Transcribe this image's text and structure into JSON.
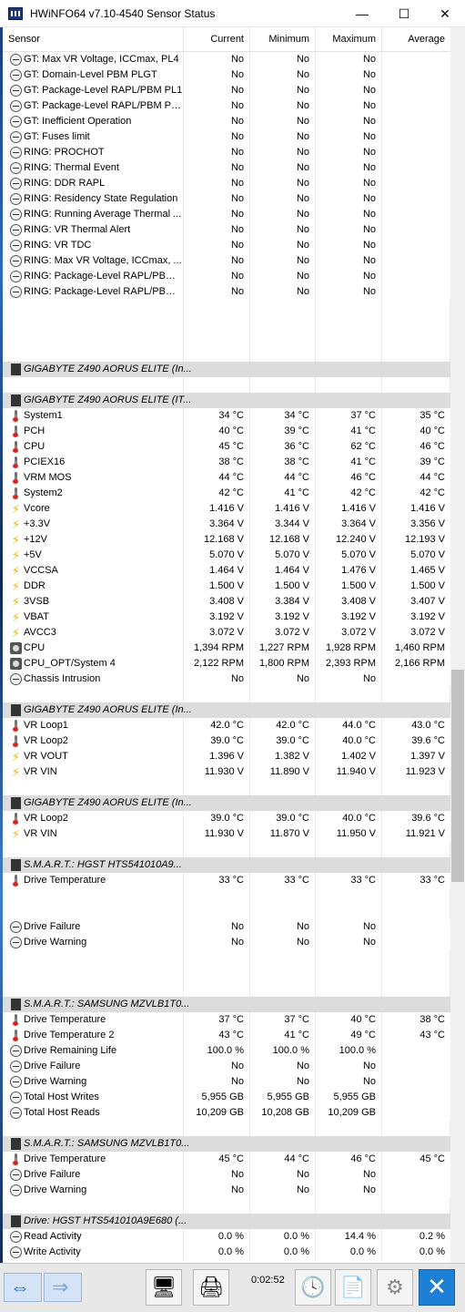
{
  "window": {
    "title": "HWiNFO64 v7.10-4540 Sensor Status"
  },
  "columns": {
    "sensor": "Sensor",
    "current": "Current",
    "minimum": "Minimum",
    "maximum": "Maximum",
    "average": "Average"
  },
  "rows": [
    {
      "type": "data",
      "icon": "clock-icon",
      "name": "GT: Max VR Voltage, ICCmax, PL4",
      "cur": "No",
      "min": "No",
      "max": "No",
      "avg": ""
    },
    {
      "type": "data",
      "icon": "clock-icon",
      "name": "GT: Domain-Level PBM PLGT",
      "cur": "No",
      "min": "No",
      "max": "No",
      "avg": ""
    },
    {
      "type": "data",
      "icon": "clock-icon",
      "name": "GT: Package-Level RAPL/PBM PL1",
      "cur": "No",
      "min": "No",
      "max": "No",
      "avg": ""
    },
    {
      "type": "data",
      "icon": "clock-icon",
      "name": "GT: Package-Level RAPL/PBM PL2...",
      "cur": "No",
      "min": "No",
      "max": "No",
      "avg": ""
    },
    {
      "type": "data",
      "icon": "clock-icon",
      "name": "GT: Inefficient Operation",
      "cur": "No",
      "min": "No",
      "max": "No",
      "avg": ""
    },
    {
      "type": "data",
      "icon": "clock-icon",
      "name": "GT: Fuses limit",
      "cur": "No",
      "min": "No",
      "max": "No",
      "avg": ""
    },
    {
      "type": "data",
      "icon": "clock-icon",
      "name": "RING: PROCHOT",
      "cur": "No",
      "min": "No",
      "max": "No",
      "avg": ""
    },
    {
      "type": "data",
      "icon": "clock-icon",
      "name": "RING: Thermal Event",
      "cur": "No",
      "min": "No",
      "max": "No",
      "avg": ""
    },
    {
      "type": "data",
      "icon": "clock-icon",
      "name": "RING: DDR RAPL",
      "cur": "No",
      "min": "No",
      "max": "No",
      "avg": ""
    },
    {
      "type": "data",
      "icon": "clock-icon",
      "name": "RING: Residency State Regulation",
      "cur": "No",
      "min": "No",
      "max": "No",
      "avg": ""
    },
    {
      "type": "data",
      "icon": "clock-icon",
      "name": "RING: Running Average Thermal ...",
      "cur": "No",
      "min": "No",
      "max": "No",
      "avg": ""
    },
    {
      "type": "data",
      "icon": "clock-icon",
      "name": "RING: VR Thermal Alert",
      "cur": "No",
      "min": "No",
      "max": "No",
      "avg": ""
    },
    {
      "type": "data",
      "icon": "clock-icon",
      "name": "RING: VR TDC",
      "cur": "No",
      "min": "No",
      "max": "No",
      "avg": ""
    },
    {
      "type": "data",
      "icon": "clock-icon",
      "name": "RING: Max VR Voltage, ICCmax, ...",
      "cur": "No",
      "min": "No",
      "max": "No",
      "avg": ""
    },
    {
      "type": "data",
      "icon": "clock-icon",
      "name": "RING: Package-Level RAPL/PBM PL1",
      "cur": "No",
      "min": "No",
      "max": "No",
      "avg": ""
    },
    {
      "type": "data",
      "icon": "clock-icon",
      "name": "RING: Package-Level RAPL/PBM ...",
      "cur": "No",
      "min": "No",
      "max": "No",
      "avg": ""
    },
    {
      "type": "empty"
    },
    {
      "type": "empty"
    },
    {
      "type": "empty"
    },
    {
      "type": "empty"
    },
    {
      "type": "group",
      "icon": "chip-icon",
      "name": "GIGABYTE Z490 AORUS ELITE (In..."
    },
    {
      "type": "empty"
    },
    {
      "type": "group",
      "icon": "chip-icon",
      "name": "GIGABYTE Z490 AORUS ELITE (IT..."
    },
    {
      "type": "data",
      "icon": "thermometer-icon",
      "name": "System1",
      "cur": "34 °C",
      "min": "34 °C",
      "max": "37 °C",
      "avg": "35 °C"
    },
    {
      "type": "data",
      "icon": "thermometer-icon",
      "name": "PCH",
      "cur": "40 °C",
      "min": "39 °C",
      "max": "41 °C",
      "avg": "40 °C"
    },
    {
      "type": "data",
      "icon": "thermometer-icon",
      "name": "CPU",
      "cur": "45 °C",
      "min": "36 °C",
      "max": "62 °C",
      "avg": "46 °C"
    },
    {
      "type": "data",
      "icon": "thermometer-icon",
      "name": "PCIEX16",
      "cur": "38 °C",
      "min": "38 °C",
      "max": "41 °C",
      "avg": "39 °C"
    },
    {
      "type": "data",
      "icon": "thermometer-icon",
      "name": "VRM MOS",
      "cur": "44 °C",
      "min": "44 °C",
      "max": "46 °C",
      "avg": "44 °C"
    },
    {
      "type": "data",
      "icon": "thermometer-icon",
      "name": "System2",
      "cur": "42 °C",
      "min": "41 °C",
      "max": "42 °C",
      "avg": "42 °C"
    },
    {
      "type": "data",
      "icon": "bolt-icon",
      "name": "Vcore",
      "cur": "1.416 V",
      "min": "1.416 V",
      "max": "1.416 V",
      "avg": "1.416 V"
    },
    {
      "type": "data",
      "icon": "bolt-icon",
      "name": "+3.3V",
      "cur": "3.364 V",
      "min": "3.344 V",
      "max": "3.364 V",
      "avg": "3.356 V"
    },
    {
      "type": "data",
      "icon": "bolt-icon",
      "name": "+12V",
      "cur": "12.168 V",
      "min": "12.168 V",
      "max": "12.240 V",
      "avg": "12.193 V"
    },
    {
      "type": "data",
      "icon": "bolt-icon",
      "name": "+5V",
      "cur": "5.070 V",
      "min": "5.070 V",
      "max": "5.070 V",
      "avg": "5.070 V"
    },
    {
      "type": "data",
      "icon": "bolt-icon",
      "name": "VCCSA",
      "cur": "1.464 V",
      "min": "1.464 V",
      "max": "1.476 V",
      "avg": "1.465 V"
    },
    {
      "type": "data",
      "icon": "bolt-icon",
      "name": "DDR",
      "cur": "1.500 V",
      "min": "1.500 V",
      "max": "1.500 V",
      "avg": "1.500 V"
    },
    {
      "type": "data",
      "icon": "bolt-icon",
      "name": "3VSB",
      "cur": "3.408 V",
      "min": "3.384 V",
      "max": "3.408 V",
      "avg": "3.407 V"
    },
    {
      "type": "data",
      "icon": "bolt-icon",
      "name": "VBAT",
      "cur": "3.192 V",
      "min": "3.192 V",
      "max": "3.192 V",
      "avg": "3.192 V"
    },
    {
      "type": "data",
      "icon": "bolt-icon",
      "name": "AVCC3",
      "cur": "3.072 V",
      "min": "3.072 V",
      "max": "3.072 V",
      "avg": "3.072 V"
    },
    {
      "type": "data",
      "icon": "fan-icon",
      "name": "CPU",
      "cur": "1,394 RPM",
      "min": "1,227 RPM",
      "max": "1,928 RPM",
      "avg": "1,460 RPM"
    },
    {
      "type": "data",
      "icon": "fan-icon",
      "name": "CPU_OPT/System 4",
      "cur": "2,122 RPM",
      "min": "1,800 RPM",
      "max": "2,393 RPM",
      "avg": "2,166 RPM"
    },
    {
      "type": "data",
      "icon": "clock-icon",
      "name": "Chassis Intrusion",
      "cur": "No",
      "min": "No",
      "max": "No",
      "avg": ""
    },
    {
      "type": "empty"
    },
    {
      "type": "group",
      "icon": "chip-icon",
      "name": "GIGABYTE Z490 AORUS ELITE (In..."
    },
    {
      "type": "data",
      "icon": "thermometer-icon",
      "name": "VR Loop1",
      "cur": "42.0 °C",
      "min": "42.0 °C",
      "max": "44.0 °C",
      "avg": "43.0 °C"
    },
    {
      "type": "data",
      "icon": "thermometer-icon",
      "name": "VR Loop2",
      "cur": "39.0 °C",
      "min": "39.0 °C",
      "max": "40.0 °C",
      "avg": "39.6 °C"
    },
    {
      "type": "data",
      "icon": "bolt-icon",
      "name": "VR VOUT",
      "cur": "1.396 V",
      "min": "1.382 V",
      "max": "1.402 V",
      "avg": "1.397 V"
    },
    {
      "type": "data",
      "icon": "bolt-icon",
      "name": "VR VIN",
      "cur": "11.930 V",
      "min": "11.890 V",
      "max": "11.940 V",
      "avg": "11.923 V"
    },
    {
      "type": "empty"
    },
    {
      "type": "group",
      "icon": "chip-icon",
      "name": "GIGABYTE Z490 AORUS ELITE (In..."
    },
    {
      "type": "data",
      "icon": "thermometer-icon",
      "name": "VR Loop2",
      "cur": "39.0 °C",
      "min": "39.0 °C",
      "max": "40.0 °C",
      "avg": "39.6 °C"
    },
    {
      "type": "data",
      "icon": "bolt-icon",
      "name": "VR VIN",
      "cur": "11.930 V",
      "min": "11.870 V",
      "max": "11.950 V",
      "avg": "11.921 V"
    },
    {
      "type": "empty"
    },
    {
      "type": "group",
      "icon": "chip-icon",
      "name": "S.M.A.R.T.: HGST HTS541010A9..."
    },
    {
      "type": "data",
      "icon": "thermometer-icon",
      "name": "Drive Temperature",
      "cur": "33 °C",
      "min": "33 °C",
      "max": "33 °C",
      "avg": "33 °C"
    },
    {
      "type": "empty"
    },
    {
      "type": "empty"
    },
    {
      "type": "data",
      "icon": "clock-icon",
      "name": "Drive Failure",
      "cur": "No",
      "min": "No",
      "max": "No",
      "avg": ""
    },
    {
      "type": "data",
      "icon": "clock-icon",
      "name": "Drive Warning",
      "cur": "No",
      "min": "No",
      "max": "No",
      "avg": ""
    },
    {
      "type": "empty"
    },
    {
      "type": "empty"
    },
    {
      "type": "empty"
    },
    {
      "type": "group",
      "icon": "chip-icon",
      "name": "S.M.A.R.T.: SAMSUNG MZVLB1T0..."
    },
    {
      "type": "data",
      "icon": "thermometer-icon",
      "name": "Drive Temperature",
      "cur": "37 °C",
      "min": "37 °C",
      "max": "40 °C",
      "avg": "38 °C"
    },
    {
      "type": "data",
      "icon": "thermometer-icon",
      "name": "Drive Temperature 2",
      "cur": "43 °C",
      "min": "41 °C",
      "max": "49 °C",
      "avg": "43 °C"
    },
    {
      "type": "data",
      "icon": "clock-icon",
      "name": "Drive Remaining Life",
      "cur": "100.0 %",
      "min": "100.0 %",
      "max": "100.0 %",
      "avg": ""
    },
    {
      "type": "data",
      "icon": "clock-icon",
      "name": "Drive Failure",
      "cur": "No",
      "min": "No",
      "max": "No",
      "avg": ""
    },
    {
      "type": "data",
      "icon": "clock-icon",
      "name": "Drive Warning",
      "cur": "No",
      "min": "No",
      "max": "No",
      "avg": ""
    },
    {
      "type": "data",
      "icon": "clock-icon",
      "name": "Total Host Writes",
      "cur": "5,955 GB",
      "min": "5,955 GB",
      "max": "5,955 GB",
      "avg": ""
    },
    {
      "type": "data",
      "icon": "clock-icon",
      "name": "Total Host Reads",
      "cur": "10,209 GB",
      "min": "10,208 GB",
      "max": "10,209 GB",
      "avg": ""
    },
    {
      "type": "empty"
    },
    {
      "type": "group",
      "icon": "chip-icon",
      "name": "S.M.A.R.T.: SAMSUNG MZVLB1T0..."
    },
    {
      "type": "data",
      "icon": "thermometer-icon",
      "name": "Drive Temperature",
      "cur": "45 °C",
      "min": "44 °C",
      "max": "46 °C",
      "avg": "45 °C"
    },
    {
      "type": "data",
      "icon": "clock-icon",
      "name": "Drive Failure",
      "cur": "No",
      "min": "No",
      "max": "No",
      "avg": ""
    },
    {
      "type": "data",
      "icon": "clock-icon",
      "name": "Drive Warning",
      "cur": "No",
      "min": "No",
      "max": "No",
      "avg": ""
    },
    {
      "type": "empty"
    },
    {
      "type": "group",
      "icon": "chip-icon",
      "name": "Drive: HGST HTS541010A9E680 (..."
    },
    {
      "type": "data",
      "icon": "clock-icon",
      "name": "Read Activity",
      "cur": "0.0 %",
      "min": "0.0 %",
      "max": "14.4 %",
      "avg": "0.2 %"
    },
    {
      "type": "data",
      "icon": "clock-icon",
      "name": "Write Activity",
      "cur": "0.0 %",
      "min": "0.0 %",
      "max": "0.0 %",
      "avg": "0.0 %"
    }
  ],
  "toolbar": {
    "elapsed": "0:02:52"
  }
}
